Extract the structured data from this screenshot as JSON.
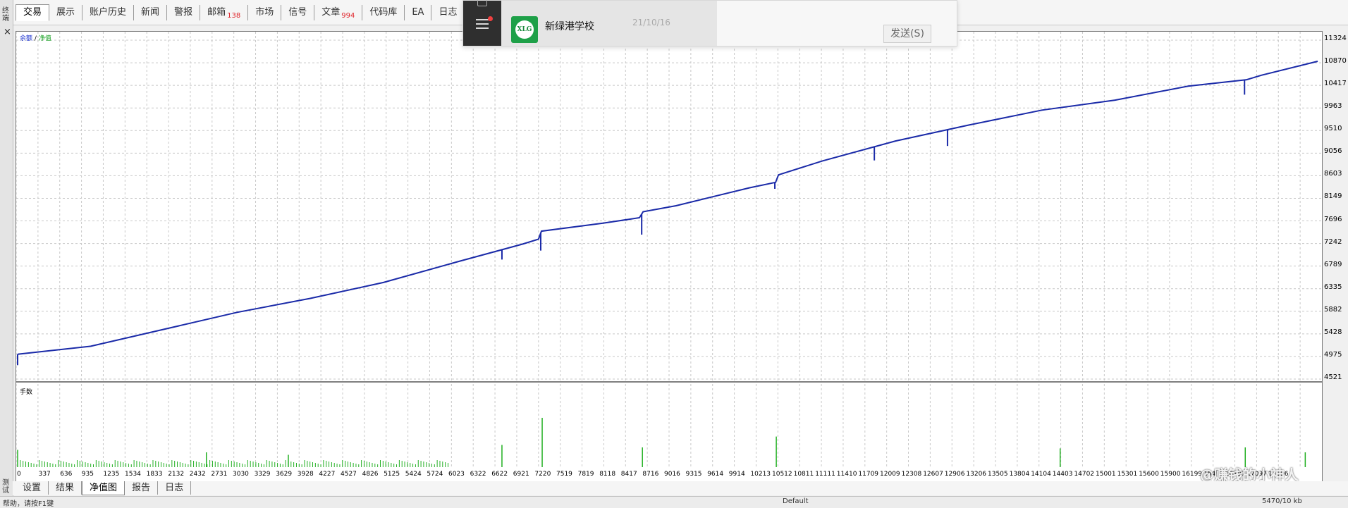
{
  "top_tabs": [
    {
      "label": "交易",
      "badge": ""
    },
    {
      "label": "展示",
      "badge": ""
    },
    {
      "label": "账户历史",
      "badge": ""
    },
    {
      "label": "新闻",
      "badge": ""
    },
    {
      "label": "警报",
      "badge": ""
    },
    {
      "label": "邮箱",
      "badge": "138"
    },
    {
      "label": "市场",
      "badge": ""
    },
    {
      "label": "信号",
      "badge": ""
    },
    {
      "label": "文章",
      "badge": "994"
    },
    {
      "label": "代码库",
      "badge": ""
    },
    {
      "label": "EA",
      "badge": ""
    },
    {
      "label": "日志",
      "badge": ""
    }
  ],
  "left_side_label": "终端",
  "left_side_label_bottom": "测试",
  "close_symbol": "×",
  "notification": {
    "name": "新绿港学校",
    "date": "21/10/16",
    "logo_text": "XLG",
    "send_button": "发送(S)",
    "menu_icon": "hamburger-menu-icon"
  },
  "legend": {
    "balance": "余额",
    "separator": "/",
    "equity": "净值"
  },
  "lower_panel_label": "手数",
  "bottom_tabs": [
    "设置",
    "结果",
    "净值图",
    "报告",
    "日志"
  ],
  "status_bar": {
    "left": "帮助，请按F1键",
    "middle": "Default",
    "right": "5470/10 kb"
  },
  "watermark": "@赚钱的小神人",
  "colors": {
    "balance_line": "#1a2aa8",
    "equity_legend": "#15a020",
    "volume_bars": "#22b022",
    "grid": "#c8c8c8",
    "badge": "#e0262c"
  },
  "chart_data": {
    "type": "line",
    "title": "",
    "series": [
      {
        "name": "余额",
        "x": [
          0,
          1000,
          2000,
          3000,
          4000,
          5000,
          6000,
          6900,
          7120,
          7160,
          8000,
          8500,
          8550,
          9000,
          10000,
          10360,
          10400,
          11000,
          12000,
          13000,
          14000,
          15000,
          16000,
          16800,
          17000,
          17770
        ],
        "values": [
          5020,
          5180,
          5520,
          5860,
          6140,
          6460,
          6870,
          7230,
          7330,
          7490,
          7650,
          7760,
          7880,
          8000,
          8360,
          8470,
          8620,
          8900,
          9300,
          9620,
          9920,
          10120,
          10400,
          10530,
          10620,
          10900
        ]
      }
    ],
    "yticks": [
      11324,
      10870,
      10417,
      9963,
      9510,
      9056,
      8603,
      8149,
      7696,
      7242,
      6789,
      6335,
      5882,
      5428,
      4975,
      4521
    ],
    "xticks": [
      0,
      337,
      636,
      935,
      1235,
      1534,
      1833,
      2132,
      2432,
      2731,
      3030,
      3329,
      3629,
      3928,
      4227,
      4527,
      4826,
      5125,
      5424,
      5724,
      6023,
      6322,
      6622,
      6921,
      7220,
      7519,
      7819,
      8118,
      8417,
      8716,
      9016,
      9315,
      9614,
      9914,
      10213,
      10512,
      10811,
      11111,
      11410,
      11709,
      12009,
      12308,
      12607,
      12906,
      13206,
      13505,
      13804,
      14104,
      14403,
      14702,
      15001,
      15301,
      15600,
      15900,
      16199,
      16498,
      16797,
      17097,
      17396
    ],
    "ylim": [
      4521,
      11324
    ],
    "drops": [
      [
        6620,
        6920
      ],
      [
        7150,
        7100
      ],
      [
        8530,
        7420
      ],
      [
        10350,
        8340
      ],
      [
        11710,
        8910
      ],
      [
        12710,
        9200
      ],
      [
        16770,
        10230
      ]
    ],
    "volume_spikes": [
      [
        0,
        0.35
      ],
      [
        2580,
        0.3
      ],
      [
        3700,
        0.25
      ],
      [
        6620,
        0.45
      ],
      [
        7170,
        1.0
      ],
      [
        8540,
        0.4
      ],
      [
        10370,
        0.62
      ],
      [
        14250,
        0.38
      ],
      [
        16780,
        0.4
      ],
      [
        17600,
        0.3
      ]
    ],
    "grid": true
  }
}
